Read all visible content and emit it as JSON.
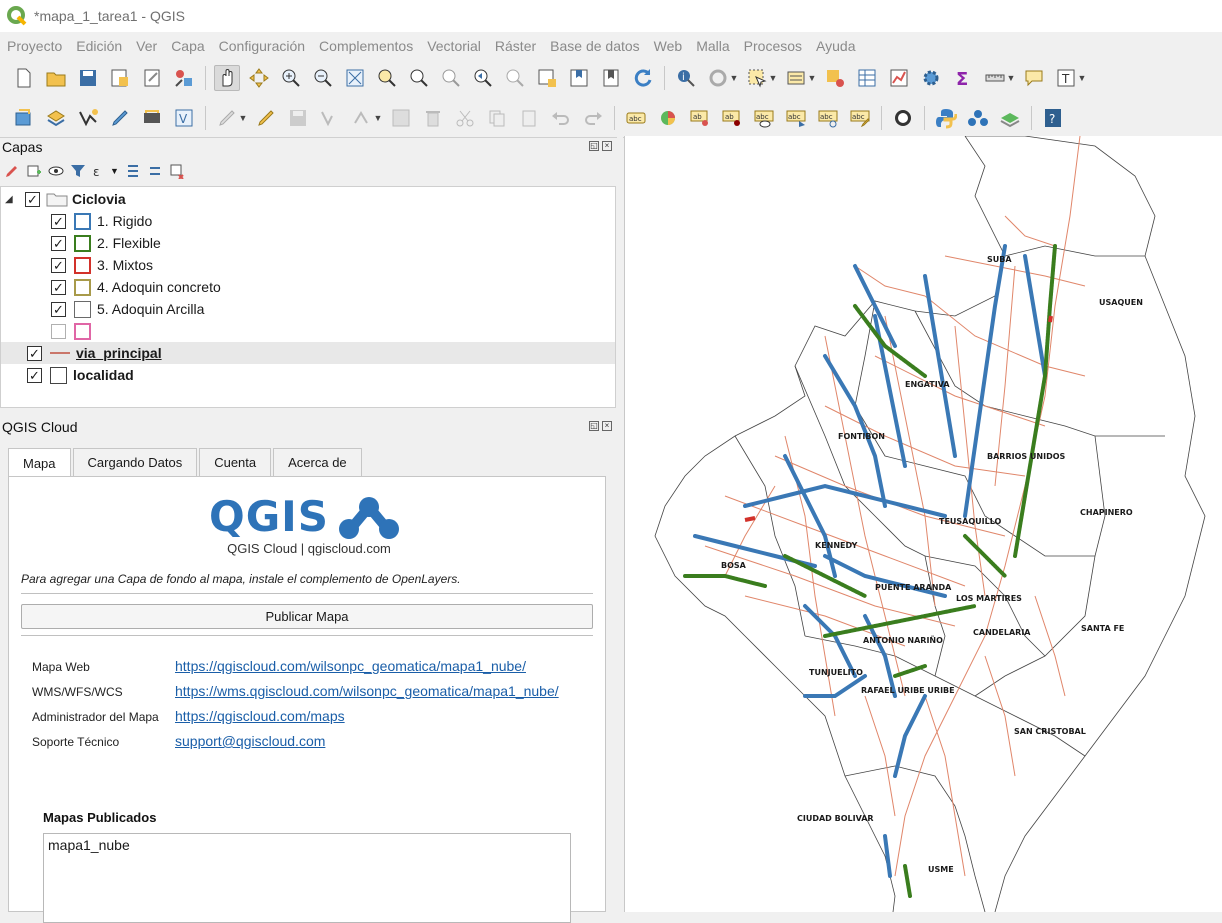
{
  "window": {
    "title": "*mapa_1_tarea1 - QGIS"
  },
  "menu": [
    "Proyecto",
    "Edición",
    "Ver",
    "Capa",
    "Configuración",
    "Complementos",
    "Vectorial",
    "Ráster",
    "Base de datos",
    "Web",
    "Malla",
    "Procesos",
    "Ayuda"
  ],
  "layers_panel": {
    "title": "Capas",
    "group": "Ciclovia",
    "items": [
      {
        "label": "1. Rigido",
        "color": "#3a78b5",
        "checked": true
      },
      {
        "label": "2. Flexible",
        "color": "#3a7d1e",
        "checked": true
      },
      {
        "label": "3. Mixtos",
        "color": "#d2312a",
        "checked": true
      },
      {
        "label": "4. Adoquin concreto",
        "color": "#a89a4a",
        "checked": true
      },
      {
        "label": "5. Adoquin Arcilla",
        "color": "#6a6a6a",
        "checked": true
      },
      {
        "label": "",
        "color": "#e066a6",
        "checked": false
      }
    ],
    "via_principal": "via_principal",
    "localidad": "localidad"
  },
  "cloud_panel": {
    "title": "QGIS Cloud",
    "tabs": [
      "Mapa",
      "Cargando Datos",
      "Cuenta",
      "Acerca de"
    ],
    "brand_text": "QGIS",
    "brand_sub": "QGIS Cloud | qgiscloud.com",
    "openlayers_note": "Para agregar una Capa de fondo al mapa, instale el complemento de OpenLayers.",
    "publish_button": "Publicar Mapa",
    "info": [
      {
        "label": "Mapa Web",
        "link": "https://qgiscloud.com/wilsonpc_geomatica/mapa1_nube/"
      },
      {
        "label": "WMS/WFS/WCS",
        "link": "https://wms.qgiscloud.com/wilsonpc_geomatica/mapa1_nube/"
      },
      {
        "label": "Administrador del Mapa",
        "link": "https://qgiscloud.com/maps"
      },
      {
        "label": "Soporte Técnico",
        "link": "support@qgiscloud.com"
      }
    ],
    "published_heading": "Mapas Publicados",
    "published_maps": [
      "mapa1_nube"
    ]
  },
  "map_labels": [
    "SUBA",
    "USAQUEN",
    "ENGATIVA",
    "FONTIBON",
    "BARRIOS UNIDOS",
    "CHAPINERO",
    "TEUSAQUILLO",
    "KENNEDY",
    "BOSA",
    "PUENTE ARANDA",
    "LOS MARTIRES",
    "SANTA FE",
    "CANDELARIA",
    "ANTONIO NARIÑO",
    "TUNJUELITO",
    "RAFAEL URIBE URIBE",
    "SAN CRISTOBAL",
    "CIUDAD BOLIVAR",
    "USME"
  ],
  "colors": {
    "rigido": "#3a78b5",
    "flexible": "#3a7d1e",
    "mixtos": "#d2312a",
    "via_principal": "#e0866a",
    "brand_blue": "#2e73b8"
  }
}
